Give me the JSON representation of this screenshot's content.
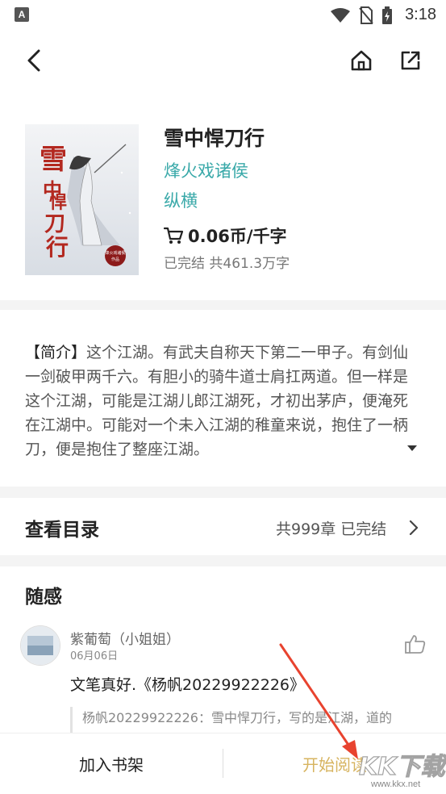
{
  "status_bar": {
    "app_badge": "A",
    "time": "3:18"
  },
  "nav": {
    "back_icon": "back-arrow-icon",
    "home_icon": "home-icon",
    "share_icon": "share-icon"
  },
  "book": {
    "title": "雪中悍刀行",
    "author": "烽火戏诸侯",
    "category": "纵横",
    "price": "0.06币/千字",
    "status": "已完结 共461.3万字",
    "cover_title": "雪中悍刀行",
    "cover_seal": "烽火戏诸侯 作品"
  },
  "intro": {
    "lead": "【简介】",
    "text": "这个江湖。有武夫自称天下第二一甲子。有剑仙一剑破甲两千六。有胆小的骑牛道士肩扛两道。但一样是这个江湖，可能是江湖儿郎江湖死，才初出茅庐，便淹死在江湖中。可能对一个未入江湖的稚童来说，抱住了一柄刀，便是抱住了整座江湖。"
  },
  "toc": {
    "title": "查看目录",
    "meta": "共999章 已完结"
  },
  "comments": {
    "section_title": "随感",
    "items": [
      {
        "user": "紫葡萄（小姐姐）",
        "date": "06月06日",
        "text": "文笔真好.《杨帆20229922226》",
        "quote": "杨帆20229922226：雪中悍刀行，写的是江湖，道的"
      }
    ]
  },
  "bottom": {
    "add_shelf": "加入书架",
    "start_reading": "开始阅读"
  },
  "watermark": {
    "text": "KK下载",
    "url": "www.kkx.net"
  },
  "colors": {
    "accent_teal": "#3aa9a9",
    "read_gold": "#d7b460",
    "annotation_red": "#e8432f"
  }
}
